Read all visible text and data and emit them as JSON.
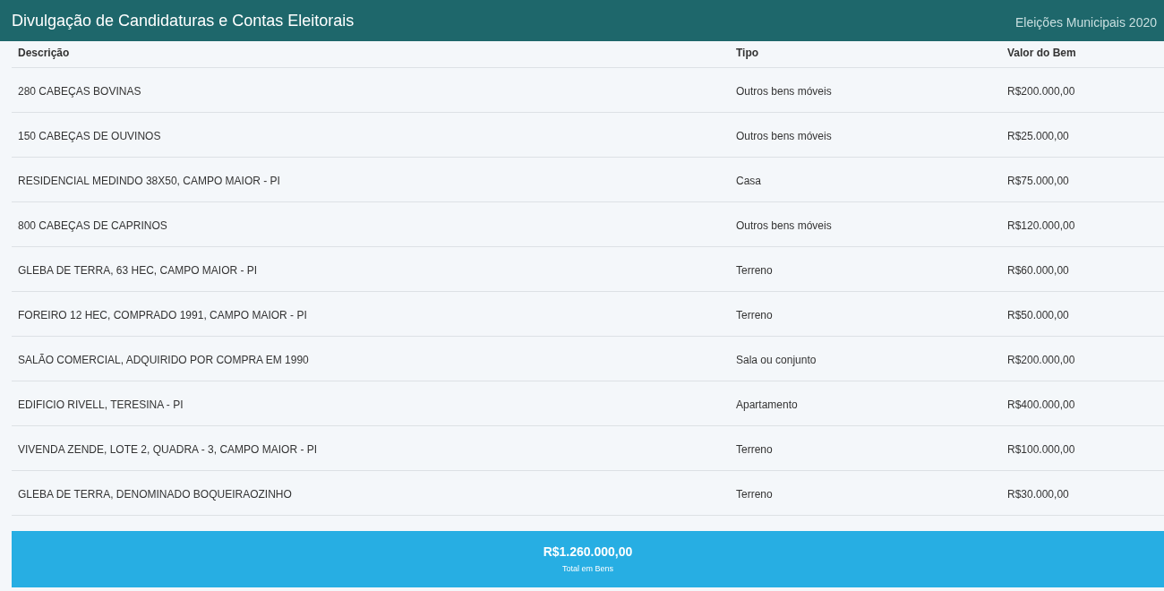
{
  "header": {
    "title": "Divulgação de Candidaturas e Contas Eleitorais",
    "subtitle": "Eleições Municipais 2020"
  },
  "table": {
    "columns": [
      "Descrição",
      "Tipo",
      "Valor do Bem"
    ],
    "rows": [
      [
        "280 CABEÇAS BOVINAS",
        "Outros bens móveis",
        "R$200.000,00"
      ],
      [
        "150 CABEÇAS DE OUVINOS",
        "Outros bens móveis",
        "R$25.000,00"
      ],
      [
        "RESIDENCIAL MEDINDO 38X50, CAMPO MAIOR - PI",
        "Casa",
        "R$75.000,00"
      ],
      [
        "800 CABEÇAS DE CAPRINOS",
        "Outros bens móveis",
        "R$120.000,00"
      ],
      [
        "GLEBA DE TERRA, 63 HEC, CAMPO MAIOR - PI",
        "Terreno",
        "R$60.000,00"
      ],
      [
        "FOREIRO 12 HEC, COMPRADO 1991, CAMPO MAIOR - PI",
        "Terreno",
        "R$50.000,00"
      ],
      [
        "SALÃO COMERCIAL, ADQUIRIDO POR COMPRA EM 1990",
        "Sala ou conjunto",
        "R$200.000,00"
      ],
      [
        "EDIFICIO RIVELL, TERESINA - PI",
        "Apartamento",
        "R$400.000,00"
      ],
      [
        "VIVENDA ZENDE, LOTE 2, QUADRA - 3, CAMPO MAIOR - PI",
        "Terreno",
        "R$100.000,00"
      ],
      [
        "GLEBA DE TERRA, DENOMINADO BOQUEIRAOZINHO",
        "Terreno",
        "R$30.000,00"
      ]
    ]
  },
  "total": {
    "value": "R$1.260.000,00",
    "label": "Total em Bens"
  }
}
